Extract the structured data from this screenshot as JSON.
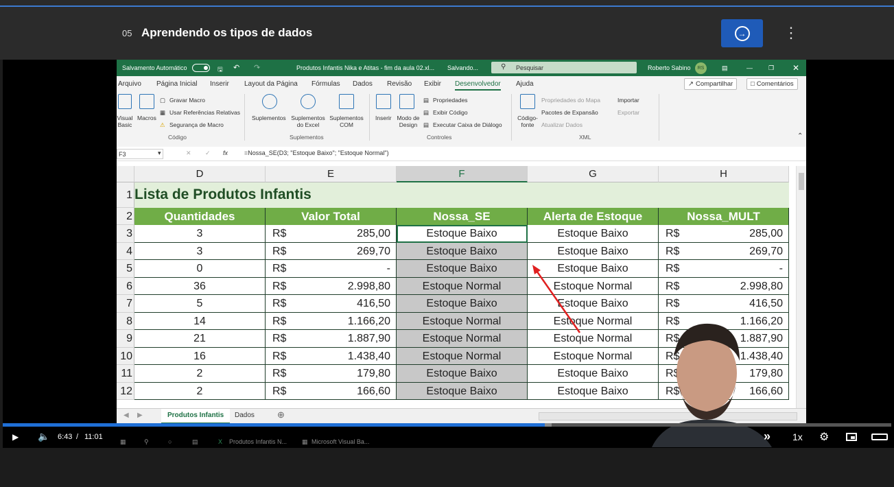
{
  "player": {
    "lesson_number": "05",
    "lesson_title": "Aprendendo os tipos de dados",
    "current_time": "6:43",
    "time_separator": "/",
    "duration": "11:01",
    "speed": "1x",
    "progress": 0.61,
    "accent": "#1f5bb8"
  },
  "excel": {
    "autosave_label": "Salvamento Automático",
    "doc_title": "Produtos Infantis Nika e Atitas - fim da aula 02.xl...",
    "saving_status": "Salvando...",
    "search_placeholder": "Pesquisar",
    "user_name": "Roberto Sabino",
    "user_initials": "RS",
    "menu": [
      "Arquivo",
      "Página Inicial",
      "Inserir",
      "Layout da Página",
      "Fórmulas",
      "Dados",
      "Revisão",
      "Exibir",
      "Desenvolvedor",
      "Ajuda"
    ],
    "share_label": "Compartilhar",
    "comments_label": "Comentários",
    "ribbon": {
      "visual_basic": "Visual Basic",
      "macros": "Macros",
      "record_macro": "Gravar Macro",
      "relative_refs": "Usar Referências Relativas",
      "macro_security": "Segurança de Macro",
      "group_code": "Código",
      "addins": "Suplementos",
      "excel_addins": "Suplementos do Excel",
      "com_addins": "Suplementos COM",
      "group_addins": "Suplementos",
      "insert": "Inserir",
      "design_mode": "Modo de Design",
      "properties": "Propriedades",
      "view_code": "Exibir Código",
      "run_dialog": "Executar Caixa de Diálogo",
      "group_controls": "Controles",
      "source": "Código-fonte",
      "map_properties": "Propriedades do Mapa",
      "expansion_packs": "Pacotes de Expansão",
      "refresh_data": "Atualizar Dados",
      "import": "Importar",
      "export": "Exportar",
      "group_xml": "XML"
    },
    "name_box": "F3",
    "formula": "=Nossa_SE(D3; \"Estoque Baixo\"; \"Estoque Normal\")",
    "columns": [
      "D",
      "E",
      "F",
      "G",
      "H"
    ],
    "list_title": "Lista de Produtos Infantis",
    "headers": [
      "Quantidades",
      "Valor Total",
      "Nossa_SE",
      "Alerta de Estoque",
      "Nossa_MULT"
    ],
    "currency": "R$",
    "rows": [
      {
        "n": "3",
        "qty": "3",
        "total": "285,00",
        "se": "Estoque Baixo",
        "alert": "Estoque Baixo",
        "mult": "285,00"
      },
      {
        "n": "4",
        "qty": "3",
        "total": "269,70",
        "se": "Estoque Baixo",
        "alert": "Estoque Baixo",
        "mult": "269,70"
      },
      {
        "n": "5",
        "qty": "0",
        "total": "-",
        "se": "Estoque Baixo",
        "alert": "Estoque Baixo",
        "mult": "-"
      },
      {
        "n": "6",
        "qty": "36",
        "total": "2.998,80",
        "se": "Estoque Normal",
        "alert": "Estoque Normal",
        "mult": "2.998,80"
      },
      {
        "n": "7",
        "qty": "5",
        "total": "416,50",
        "se": "Estoque Baixo",
        "alert": "Estoque Baixo",
        "mult": "416,50"
      },
      {
        "n": "8",
        "qty": "14",
        "total": "1.166,20",
        "se": "Estoque Normal",
        "alert": "Estoque Normal",
        "mult": "1.166,20"
      },
      {
        "n": "9",
        "qty": "21",
        "total": "1.887,90",
        "se": "Estoque Normal",
        "alert": "Estoque Normal",
        "mult": "1.887,90"
      },
      {
        "n": "10",
        "qty": "16",
        "total": "1.438,40",
        "se": "Estoque Normal",
        "alert": "Estoque Normal",
        "mult": "1.438,40"
      },
      {
        "n": "11",
        "qty": "2",
        "total": "179,80",
        "se": "Estoque Baixo",
        "alert": "Estoque Baixo",
        "mult": "179,80"
      },
      {
        "n": "12",
        "qty": "2",
        "total": "166,60",
        "se": "Estoque Baixo",
        "alert": "Estoque Baixo",
        "mult": "166,60"
      }
    ],
    "sheets": [
      "Produtos Infantis",
      "Dados"
    ]
  },
  "taskbar": {
    "items": [
      "Produtos Infantis N...",
      "Microsoft Visual Ba..."
    ]
  },
  "colors": {
    "excel_green": "#1e7145",
    "header_green": "#70ad47",
    "selection_gray": "#c8c8c8"
  }
}
